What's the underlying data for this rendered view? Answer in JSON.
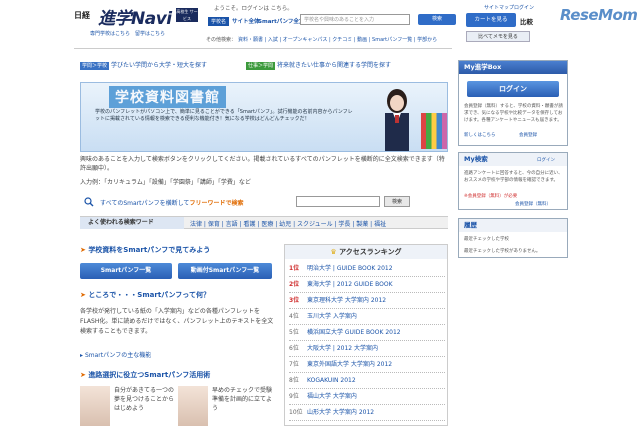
{
  "header": {
    "logo_small": "日経",
    "logo_main": "進学Navi",
    "logo_badge": "高校生 サービス",
    "sublinks": "専門学校はこちら　留学はこちら",
    "welcome": "ようこそ。ログインは こちら。",
    "search_tag": "学校名",
    "search_label": "サイト全体",
    "search_label2": "Smartパンフ全文",
    "search_placeholder": "学校名や興味のあることを入力",
    "search_button": "検索",
    "nav_label": "その他検索：",
    "nav_links": "資料・願書 | 入試 | オープンキャンパス | クチコミ | 動画 | Smartパンフ一覧 | 学部から",
    "sitemap": "サイトマップ",
    "login_link": "ログイン",
    "cart_button": "カートを見る",
    "compare": "比較",
    "memo_button": "比べてメモを見る",
    "watermark": "ReseMom"
  },
  "purpose": {
    "tag1": "学問＞学校",
    "text1": "学びたい学問から大学・短大を探す",
    "tag2": "仕事＞学問",
    "text2": "将来就きたい仕事から関連する学問を探す"
  },
  "banner": {
    "title": "学校資料図書館",
    "text": "学校のパンフレットがパソコン上で、簡単に見ることができる「Smartパンフ」。試行機能の名前内容からパンフレットに掲載されている情報を検索できる便利な機能付き！気になる学校はどんどんチェックだ！"
  },
  "intro": {
    "line1": "興味のあることを入力して検索ボタンをクリックしてください。掲載されているすべてのパンフレットを横断的に全文検索できます（特許出願中）。",
    "example": "入力例：「カリキュラム」「設備」「学園祭」「講師」「学費」など"
  },
  "freeword": {
    "label_prefix": "すべてのSmartパンフを横断して",
    "label_highlight": "フリーワードで検索",
    "button": "検索"
  },
  "keywords": {
    "head": "よく使われる検索ワード",
    "list": "法律 | 保育 | 言語 | 看護 | 医療 | 幼児 | スクジュール | 学長 | 製薬 | 福祉"
  },
  "left": {
    "sec1_title": "学校資料をSmartパンフで見てみよう",
    "btn1": "Smartパンフ一覧",
    "btn2": "動画付Smartパンフ一覧",
    "sec2_title": "ところで・・・Smartパンフって何？",
    "sec2_text": "各学校が発行している紙の「入学案内」などの各種パンフレットをFLASH化。単に読めるだけではなく、パンフレット上のテキストを全文検索することもできます。",
    "sec2_link": "Smartパンフの主な機能",
    "sec3_title": "進路選択に役立つSmartパンフ活用術",
    "card1_text": "自分があきてる一つの夢を見つけることからはじめよう",
    "card2_text": "早めのチェックで受験準備を計画的に立てよう"
  },
  "ranking": {
    "title": "アクセスランキング",
    "items": [
      {
        "rank": "1位",
        "name": "明治大学 | GUIDE BOOK 2012"
      },
      {
        "rank": "2位",
        "name": "東海大学 | 2012 GUIDE BOOK"
      },
      {
        "rank": "3位",
        "name": "東京理科大学 大学案内 2012"
      },
      {
        "rank": "4位",
        "name": "玉川大学 入学案内"
      },
      {
        "rank": "5位",
        "name": "横浜国立大学 GUIDE BOOK 2012"
      },
      {
        "rank": "6位",
        "name": "大阪大学 | 2012 大学案内"
      },
      {
        "rank": "7位",
        "name": "東京外国語大学 大学案内 2012"
      },
      {
        "rank": "8位",
        "name": "KOGAKUIN 2012"
      },
      {
        "rank": "9位",
        "name": "福山大学 大学案内"
      },
      {
        "rank": "10位",
        "name": "山形大学 大学案内 2012"
      }
    ]
  },
  "right": {
    "box1_title": "My進学Box",
    "login_button": "ログイン",
    "box1_text": "会員登録（無料）すると、学校の資料・願書が請求でき、気になる学校や比較データを保存しておけます。各種アンケートやニュースも届きます。",
    "box1_link1": "新しくはこちら",
    "box1_link2": "会員登録",
    "box2_title": "My検索",
    "box2_link": "ログイン",
    "box2_text": "進路アンケートに回答すると、今の自分に近い、おススメの学校や学部の情報を確認できます。",
    "box2_link_red": "※会員登録（無料）が必要",
    "box2_link2": "会員登録（無料）",
    "box3_title": "履歴",
    "box3_item1": "最近チェックした学校",
    "box3_item2": "最近チェックした学校がありません。"
  },
  "colors": {
    "accent": "#1a53a8",
    "highlight": "#e06a00",
    "rank_red": "#d03030"
  }
}
